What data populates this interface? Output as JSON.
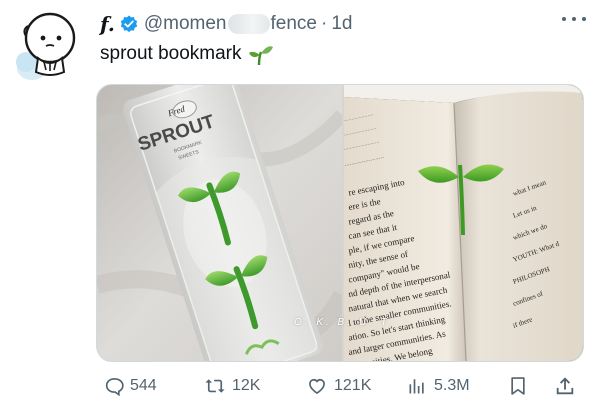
{
  "tweet": {
    "display_name": "f.",
    "handle_prefix": "@momen",
    "handle_suffix": "fence",
    "separator": "·",
    "timestamp": "1d",
    "text": "sprout bookmark"
  },
  "media": {
    "package_brand": "Fred",
    "package_title": "SPROUT",
    "package_subtitle": "BOOKMARK",
    "package_subtitle2": "SWEETS",
    "watermark": "O. K. B. U. T",
    "book_lines": [
      "re escaping into",
      "ere is the",
      "regard as the",
      "can see that it",
      "ple, if we compare",
      "nity, the sense of",
      "company\" would be",
      "nd depth of the interpersonal",
      "natural that when we search",
      "l to the smaller communities.",
      "ation. So let's start thinking",
      "and larger communities. As",
      "ommunities. We belong"
    ],
    "book_right_lines": [
      "what I mean",
      "Let us in",
      "which we do",
      "YOUTH: What d",
      "PHILOSOPH",
      "confines of",
      "if there"
    ]
  },
  "actions": {
    "replies": "544",
    "reposts": "12K",
    "likes": "121K",
    "views": "5.3M"
  },
  "colors": {
    "text_primary": "#0f1419",
    "text_secondary": "#536471",
    "verified_blue": "#1d9bf0",
    "sprout_green": "#4caf2f"
  }
}
